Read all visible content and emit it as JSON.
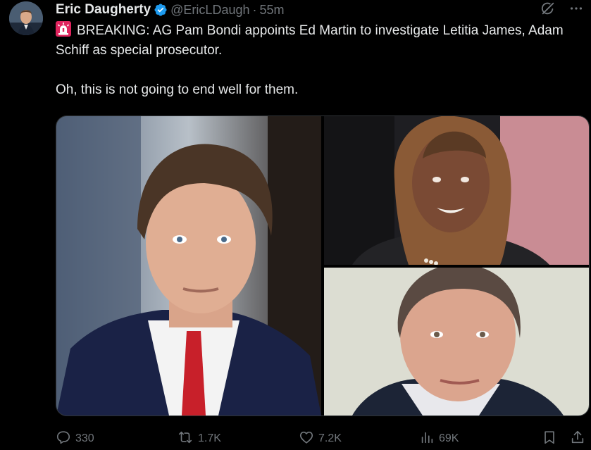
{
  "author": {
    "name": "Eric Daugherty",
    "handle": "@EricLDaugh",
    "separator": "·",
    "time": "55m",
    "verified": true
  },
  "tweet": {
    "line1": "BREAKING: AG Pam Bondi appoints Ed Martin to investigate Letitia James, Adam Schiff as special prosecutor.",
    "line2": "Oh, this is not going to end well for them.",
    "leading_emoji": "siren-icon"
  },
  "media": {
    "layout": "three-photo grid",
    "photos": [
      "man-in-suit-photo",
      "woman-portrait-photo",
      "man-closeup-photo"
    ]
  },
  "actions": {
    "replies": "330",
    "reposts": "1.7K",
    "likes": "7.2K",
    "views": "69K"
  },
  "icons": {
    "reply": "reply-icon",
    "repost": "repost-icon",
    "like": "like-icon",
    "views": "views-icon",
    "bookmark": "bookmark-icon",
    "share": "share-icon",
    "grok": "grok-icon",
    "more": "more-icon"
  },
  "colors": {
    "background": "#000000",
    "text": "#e7e9ea",
    "secondary": "#71767b",
    "verified": "#1d9bf0",
    "border": "#2f3336",
    "siren": "#e0245e"
  }
}
